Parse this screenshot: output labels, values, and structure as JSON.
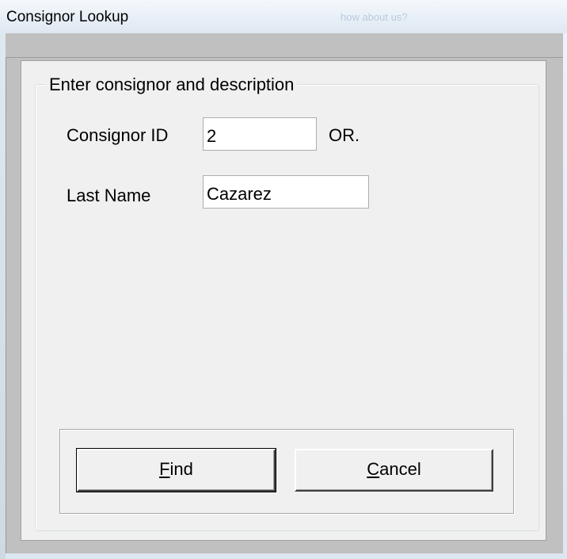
{
  "window": {
    "title": "Consignor Lookup",
    "background_hint": "how about us?"
  },
  "group": {
    "legend": "Enter consignor and description"
  },
  "fields": {
    "consignor_id_label": "Consignor ID",
    "consignor_id_value": "2",
    "or_label": "OR.",
    "last_name_label": "Last Name",
    "last_name_value": "Cazarez"
  },
  "buttons": {
    "find": {
      "accel": "F",
      "rest": "ind"
    },
    "cancel": {
      "accel": "C",
      "rest": "ancel"
    }
  }
}
